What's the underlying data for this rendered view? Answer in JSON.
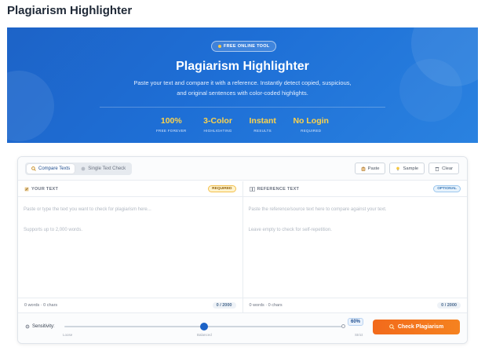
{
  "page": {
    "title": "Plagiarism Highlighter"
  },
  "hero": {
    "badge": "FREE ONLINE TOOL",
    "title": "Plagiarism Highlighter",
    "desc_line1": "Paste your text and compare it with a reference. Instantly detect copied, suspicious,",
    "desc_line2": "and original sentences with color-coded highlights.",
    "stats": [
      {
        "value": "100%",
        "label": "FREE FOREVER"
      },
      {
        "value": "3-Color",
        "label": "HIGHLIGHTING"
      },
      {
        "value": "Instant",
        "label": "RESULTS"
      },
      {
        "value": "No Login",
        "label": "REQUIRED"
      }
    ]
  },
  "modes": [
    {
      "label": "Compare Texts",
      "icon": "search-icon",
      "active": true
    },
    {
      "label": "Single Text Check",
      "icon": "circle-icon",
      "active": false
    }
  ],
  "toolbar": {
    "paste_label": "Paste",
    "sample_label": "Sample",
    "clear_label": "Clear"
  },
  "your_text": {
    "title": "YOUR TEXT",
    "tag": "REQUIRED",
    "placeholder_line1": "Paste or type the text you want to check for plagiarism here...",
    "placeholder_line2": "Supports up to 2,000 words.",
    "count": "0 words · 0 chars",
    "limit": "0 / 2000"
  },
  "reference_text": {
    "title": "REFERENCE TEXT",
    "tag": "OPTIONAL",
    "placeholder_line1": "Paste the reference/source text here to compare against your text.",
    "placeholder_line2": "Leave empty to check for self-repetition.",
    "count": "0 words · 0 chars",
    "limit": "0 / 2000"
  },
  "sensitivity": {
    "label": "Sensitivity:",
    "value_fraction": 0.5,
    "value_text": "60%",
    "ticks": {
      "left": "Loose",
      "mid": "Balanced",
      "right": "Strict"
    }
  },
  "check_button": {
    "label": "Check Plagiarism"
  },
  "colors": {
    "hero_blue": "#1d63c7",
    "accent_orange": "#f26a1b",
    "stat_yellow": "#fcd34d"
  }
}
